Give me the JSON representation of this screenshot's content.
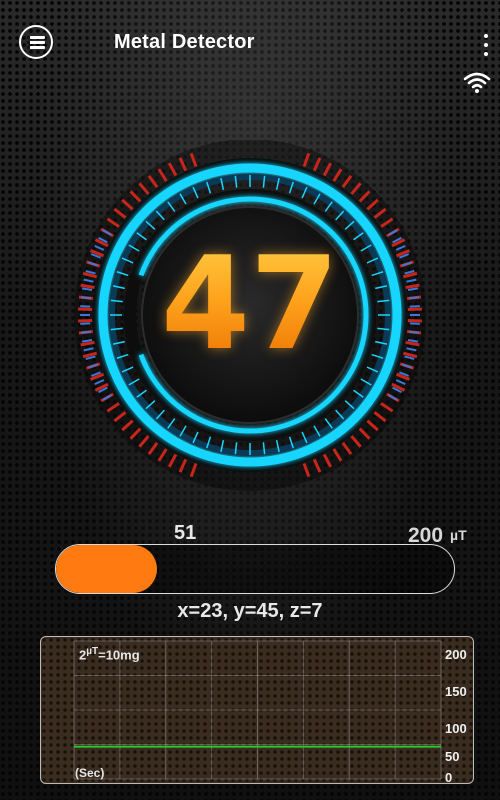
{
  "app_bar": {
    "title": "Metal Detector",
    "menu_icon": "menu-icon",
    "overflow_icon": "more-vert-icon",
    "status_icon": "wifi-icon"
  },
  "gauge": {
    "reading": "47",
    "reading_value": 47,
    "ring_color": "#19d6ff",
    "reading_color": "#ff9a1a"
  },
  "field_bar": {
    "current_label": "51",
    "max_label": "200",
    "unit": "µT",
    "current_value": 51,
    "max_value": 200,
    "fill_color": "#ff7a10"
  },
  "axes_readout": "x=23, y=45, z=7",
  "graph": {
    "scale_prefix": "2",
    "scale_unit": "µT",
    "scale_suffix": "=10mg",
    "x_label": "(Sec)",
    "y_ticks": [
      "200",
      "150",
      "100",
      "50",
      "0"
    ],
    "line_color": "#2ec82e",
    "chart_data": {
      "type": "line",
      "ylim": [
        0,
        200
      ],
      "series": [
        {
          "values": [
            47,
            47,
            47,
            47,
            47,
            47,
            47,
            47,
            47,
            47
          ]
        }
      ]
    }
  }
}
